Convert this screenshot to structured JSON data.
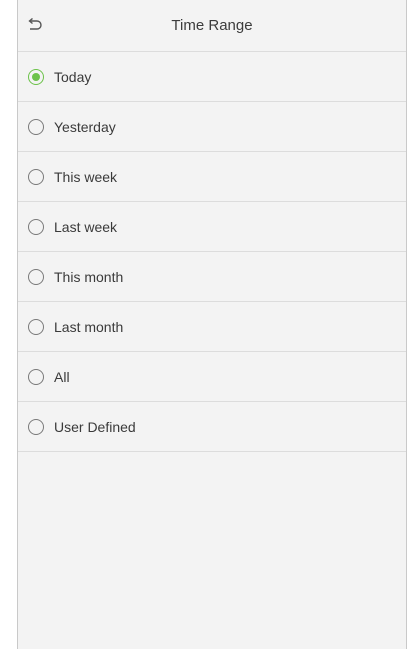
{
  "header": {
    "title": "Time Range",
    "back_icon": "undo-arrow-icon"
  },
  "colors": {
    "accent": "#6cc24a",
    "background": "#f3f3f3",
    "divider": "#dcdcdc"
  },
  "options": [
    {
      "label": "Today",
      "checked": true
    },
    {
      "label": "Yesterday",
      "checked": false
    },
    {
      "label": "This week",
      "checked": false
    },
    {
      "label": "Last week",
      "checked": false
    },
    {
      "label": "This month",
      "checked": false
    },
    {
      "label": "Last month",
      "checked": false
    },
    {
      "label": "All",
      "checked": false
    },
    {
      "label": "User Defined",
      "checked": false
    }
  ]
}
